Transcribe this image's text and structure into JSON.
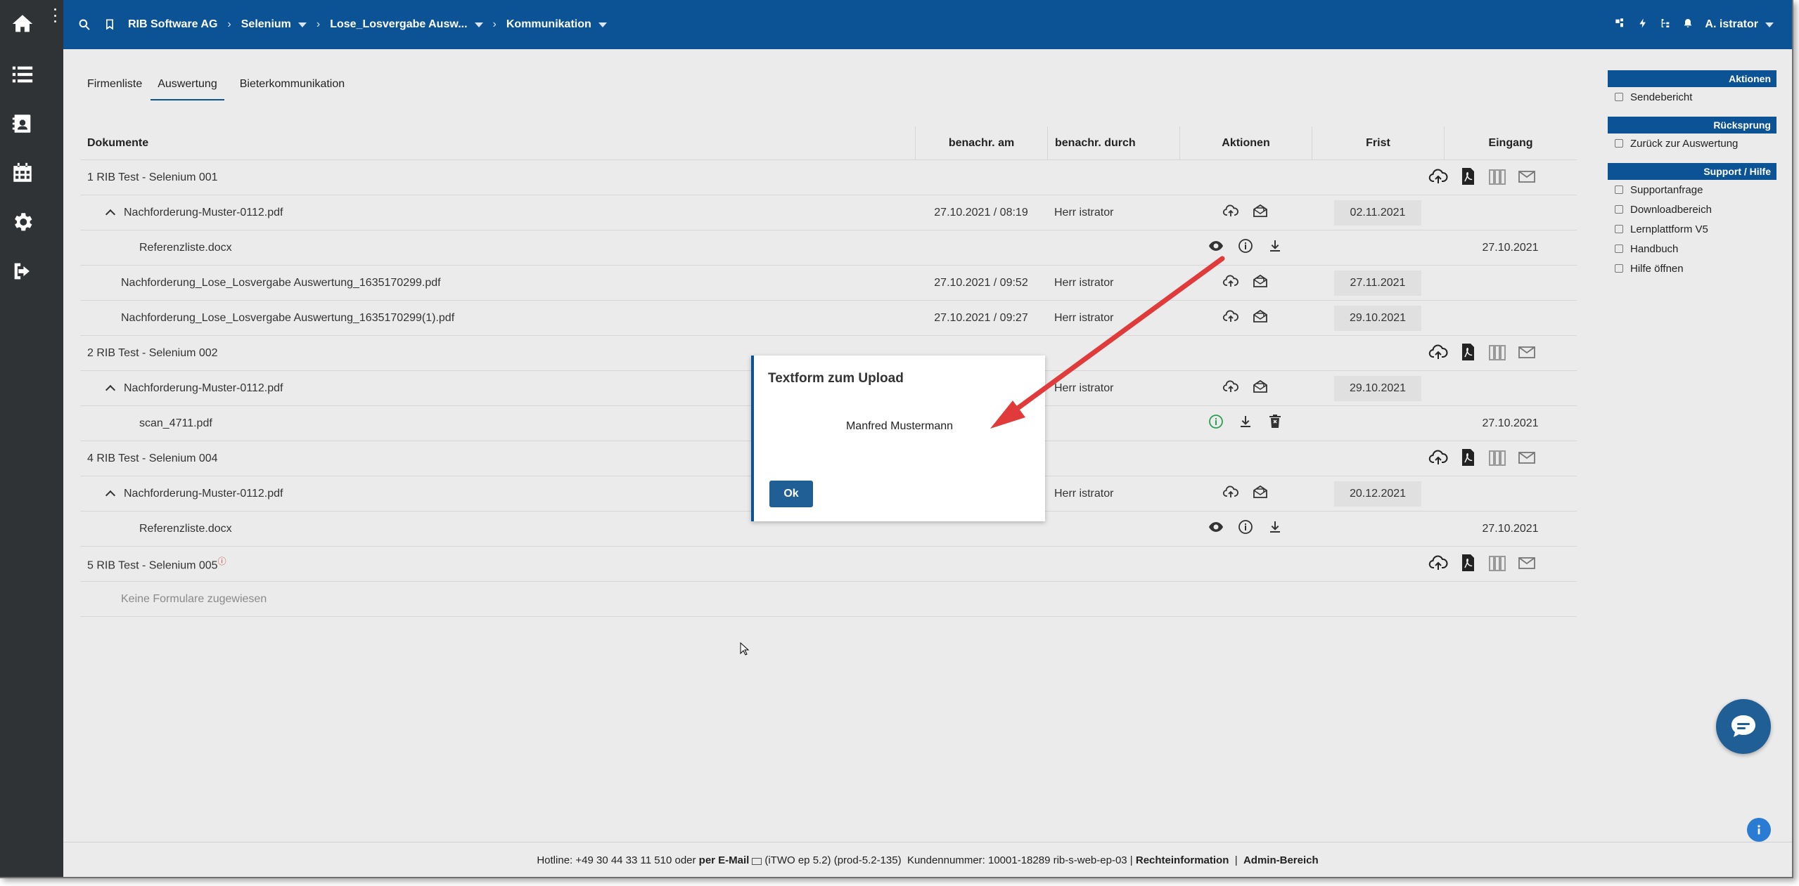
{
  "topbar": {
    "breadcrumbs": [
      "RIB Software AG",
      "Selenium",
      "Lose_Losvergabe Ausw...",
      "Kommunikation"
    ],
    "user": "A. istrator"
  },
  "tabs": [
    {
      "label": "Firmenliste",
      "active": false
    },
    {
      "label": "Auswertung",
      "active": true
    },
    {
      "label": "Bieterkommunikation",
      "active": false
    }
  ],
  "table": {
    "headers": {
      "doc": "Dokumente",
      "date": "benachr. am",
      "by": "benachr. durch",
      "actions": "Aktionen",
      "deadline": "Frist",
      "received": "Eingang"
    },
    "rows": [
      {
        "doc": "1 RIB Test - Selenium 001",
        "date": "",
        "by": "",
        "deadline": "",
        "received": ""
      },
      {
        "doc": "Nachforderung-Muster-0112.pdf",
        "date": "27.10.2021 / 08:19",
        "by": "Herr istrator",
        "deadline": "02.11.2021",
        "received": ""
      },
      {
        "doc": "Referenzliste.docx",
        "date": "",
        "by": "",
        "deadline": "",
        "received": "27.10.2021"
      },
      {
        "doc": "Nachforderung_Lose_Losvergabe Auswertung_1635170299.pdf",
        "date": "27.10.2021 / 09:52",
        "by": "Herr istrator",
        "deadline": "27.11.2021",
        "received": ""
      },
      {
        "doc": "Nachforderung_Lose_Losvergabe Auswertung_1635170299(1).pdf",
        "date": "27.10.2021 / 09:27",
        "by": "Herr istrator",
        "deadline": "29.10.2021",
        "received": ""
      },
      {
        "doc": "2 RIB Test - Selenium 002",
        "date": "",
        "by": "",
        "deadline": "",
        "received": ""
      },
      {
        "doc": "Nachforderung-Muster-0112.pdf",
        "date": "",
        "by": "Herr istrator",
        "deadline": "29.10.2021",
        "received": ""
      },
      {
        "doc": "scan_4711.pdf",
        "date": "",
        "by": "",
        "deadline": "",
        "received": "27.10.2021"
      },
      {
        "doc": "4 RIB Test - Selenium 004",
        "date": "",
        "by": "",
        "deadline": "",
        "received": ""
      },
      {
        "doc": "Nachforderung-Muster-0112.pdf",
        "date": "",
        "by": "Herr istrator",
        "deadline": "20.12.2021",
        "received": ""
      },
      {
        "doc": "Referenzliste.docx",
        "date": "",
        "by": "",
        "deadline": "",
        "received": "27.10.2021"
      },
      {
        "doc": "5 RIB Test - Selenium 005",
        "date": "",
        "by": "",
        "deadline": "",
        "received": ""
      },
      {
        "doc": "Keine Formulare zugewiesen",
        "date": "",
        "by": "",
        "deadline": "",
        "received": ""
      }
    ]
  },
  "rpanel": {
    "actions_head": "Aktionen",
    "actions": [
      "Sendebericht"
    ],
    "back_head": "Rücksprung",
    "back": [
      "Zurück zur Auswertung"
    ],
    "support_head": "Support / Hilfe",
    "support": [
      "Supportanfrage",
      "Downloadbereich",
      "Lernplattform V5",
      "Handbuch",
      "Hilfe öffnen"
    ]
  },
  "modal": {
    "title": "Textform zum Upload",
    "text": "Manfred Mustermann",
    "ok": "Ok"
  },
  "footer": {
    "hotline": "Hotline: +49 30 44 33 11 510 oder",
    "email": "per E-Mail",
    "version": "(iTWO ep 5.2) (prod-5.2-135)",
    "customer": "Kundennummer: 10001-18289 rib-s-web-ep-03 |",
    "legal": "Rechteinformation",
    "sep": "|",
    "admin": "Admin-Bereich"
  },
  "colors": {
    "brand": "#0b5394",
    "rail": "#2f3336",
    "arrow": "#e03a3a",
    "ok_icon": "#2e9d55"
  }
}
